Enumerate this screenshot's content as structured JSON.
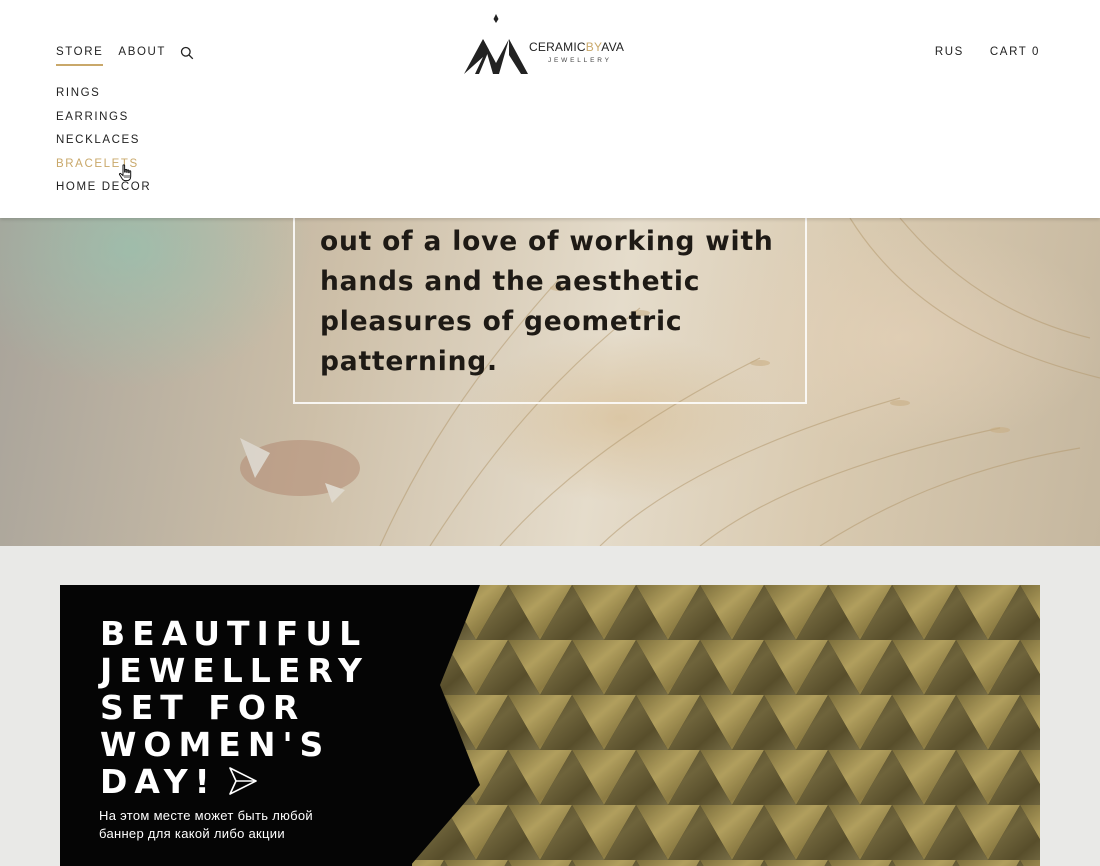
{
  "nav": {
    "store": "STORE",
    "about": "ABOUT",
    "language": "RUS",
    "cart": "CART 0"
  },
  "submenu": [
    {
      "label": "RINGS",
      "active": false
    },
    {
      "label": "EARRINGS",
      "active": false
    },
    {
      "label": "NECKLACES",
      "active": false
    },
    {
      "label": "BRACELETS",
      "active": true
    },
    {
      "label": "HOME DECOR",
      "active": false
    }
  ],
  "logo": {
    "part1": "CERAMIC",
    "part2": "BY",
    "part3": "AVA",
    "sub": "JEWELLERY"
  },
  "hero": {
    "text": "out of a love of working with hands and the aesthetic pleasures of geometric patterning."
  },
  "banner": {
    "title": "BEAUTIFUL JEWELLERY SET FOR WOMEN'S DAY!",
    "subtitle": "На этом месте может быть любой баннер для какой либо акции"
  },
  "colors": {
    "accent": "#c9a86a",
    "text": "#222222",
    "banner_bg": "#050505"
  },
  "icons": {
    "search": "search-icon",
    "cursor": "hand-pointer-icon",
    "arrow": "send-arrow-icon"
  }
}
